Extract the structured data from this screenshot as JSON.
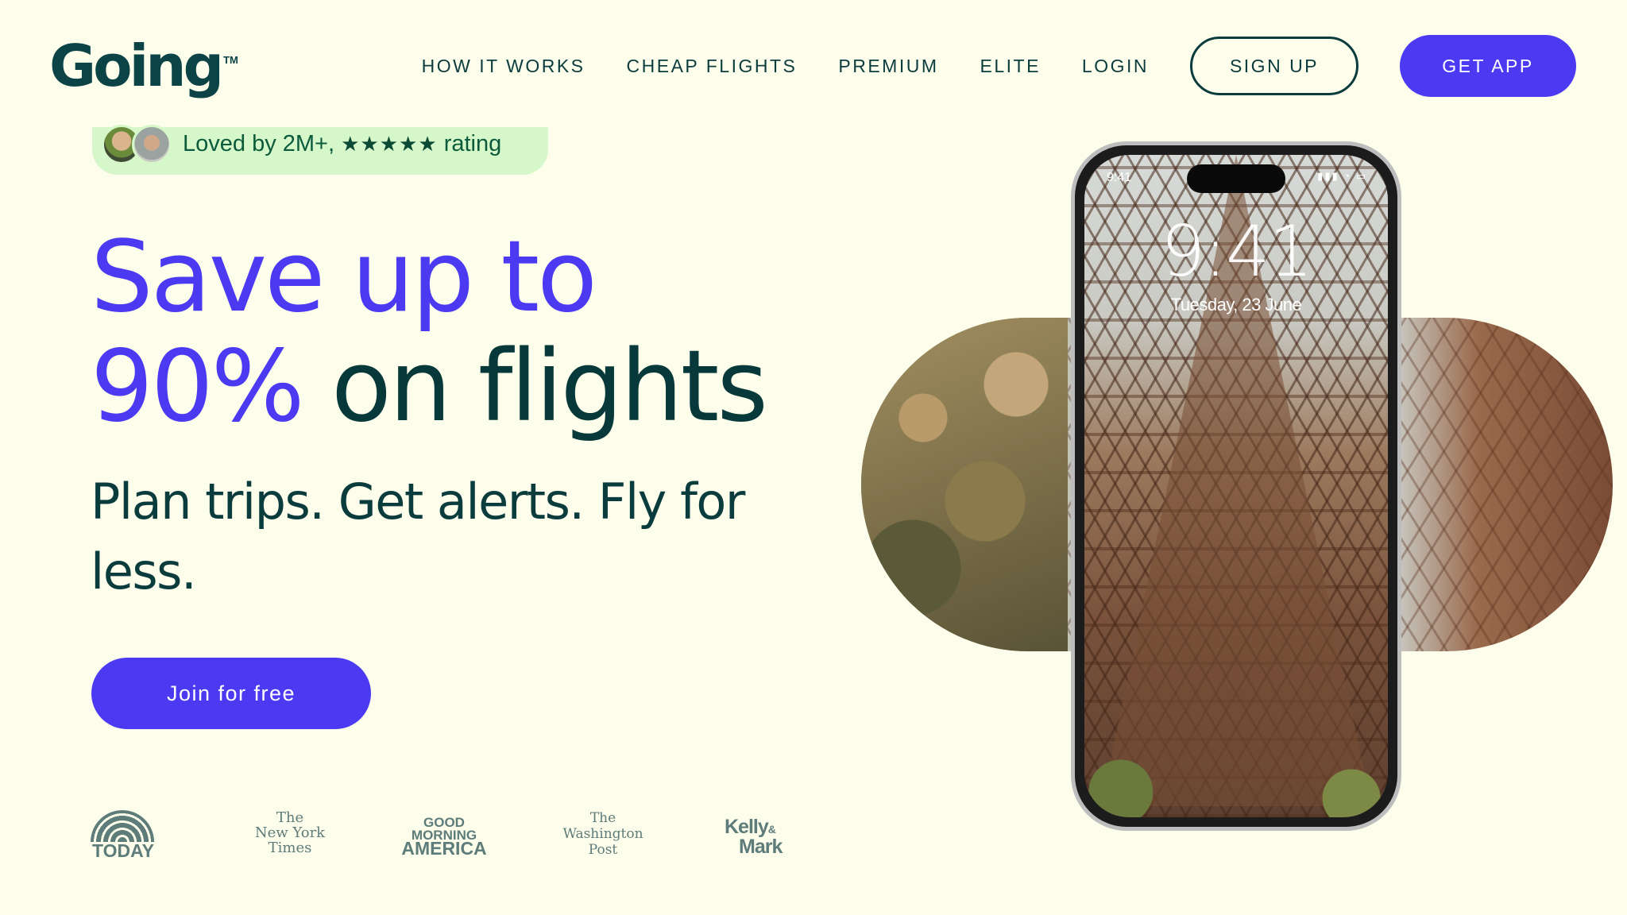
{
  "brand": {
    "name": "Going",
    "trademark": "TM"
  },
  "nav": {
    "links": [
      "HOW IT WORKS",
      "CHEAP FLIGHTS",
      "PREMIUM",
      "ELITE",
      "LOGIN"
    ],
    "signup": "SIGN UP",
    "get_app": "GET APP"
  },
  "rating": {
    "text_prefix": "Loved by 2M+,",
    "stars": "★★★★★",
    "text_suffix": "rating",
    "star_value": 4.5
  },
  "hero": {
    "title_line1": "Save up to",
    "title_line2_accent": "90%",
    "title_line2_rest": "on flights",
    "subtitle": "Plan trips. Get alerts. Fly for less.",
    "cta": "Join for free"
  },
  "press": {
    "today": "TODAY",
    "nyt": [
      "The",
      "New York",
      "Times"
    ],
    "gma": [
      "GOOD",
      "MORNING",
      "AMERICA"
    ],
    "wapo": [
      "The",
      "Washington",
      "Post"
    ],
    "kelly_mark": [
      "Kelly",
      "&",
      "Mark"
    ]
  },
  "phone": {
    "status_time": "9:41",
    "lock_time": "9:41",
    "lock_date": "Tuesday, 23 June"
  },
  "colors": {
    "background": "#fdfdeb",
    "accent": "#4b3af2",
    "dark_teal": "#08393a",
    "rating_pill": "#d6f7c9"
  }
}
